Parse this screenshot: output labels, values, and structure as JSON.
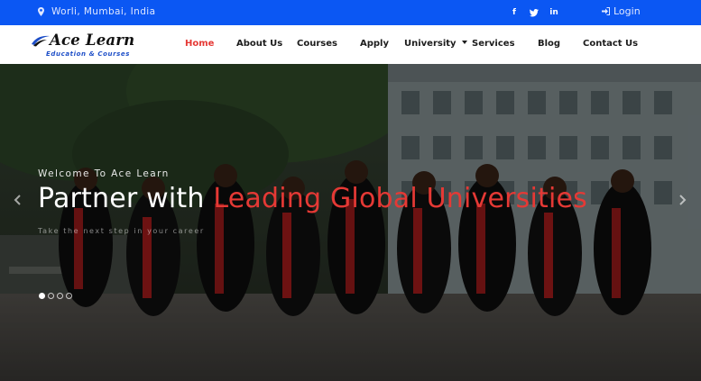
{
  "topbar": {
    "location": "Worli, Mumbai, India",
    "social": [
      {
        "name": "facebook",
        "glyph": "f"
      },
      {
        "name": "twitter",
        "glyph": "t"
      },
      {
        "name": "linkedin",
        "glyph": "in"
      }
    ],
    "login_label": "Login"
  },
  "logo": {
    "brand": "Ace Learn",
    "tagline": "Education & Courses"
  },
  "nav": {
    "items": [
      {
        "label": "Home",
        "active": true
      },
      {
        "label": "About Us"
      },
      {
        "label": "Courses"
      },
      {
        "label": "Apply"
      },
      {
        "label": "University",
        "has_dropdown": true
      },
      {
        "label": "Services"
      },
      {
        "label": "Blog"
      },
      {
        "label": "Contact Us"
      }
    ]
  },
  "hero": {
    "welcome": "Welcome To Ace Learn",
    "headline_plain": "Partner with ",
    "headline_highlight": "Leading Global Universities",
    "subline": "Take the next step in your career",
    "slides": {
      "count": 4,
      "active_index": 0
    },
    "prev_icon": "chevron-left-icon",
    "next_icon": "chevron-right-icon"
  },
  "colors": {
    "topbar_bg": "#0b57f3",
    "accent": "#e53935",
    "brand_blue": "#1e4fc8"
  }
}
